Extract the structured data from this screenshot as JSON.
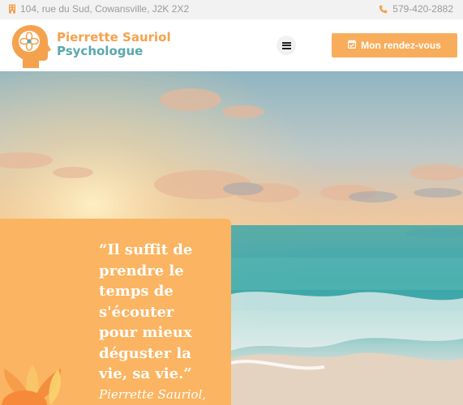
{
  "topbar": {
    "address": "104, rue du Sud, Cowansville, J2K 2X2",
    "phone": "579-420-2882",
    "icons": {
      "address": "building-icon",
      "phone": "phone-icon"
    }
  },
  "header": {
    "brand_name": "Pierrette Sauriol",
    "brand_title": "Psychologue",
    "menu_icon": "hamburger-menu-icon",
    "cta_label": "Mon rendez-vous",
    "cta_icon": "calendar-check-icon"
  },
  "hero": {
    "quote": "“Il suffit de\nprendre le\ntemps de\ns'écouter\npour mieux\ndéguster la\nvie, sa vie.”",
    "signature": "Pierrette Sauriol,"
  },
  "colors": {
    "accent_orange": "#f8ad5c",
    "brand_teal": "#5aa8ad",
    "topbar_bg": "#f2f2f2"
  }
}
